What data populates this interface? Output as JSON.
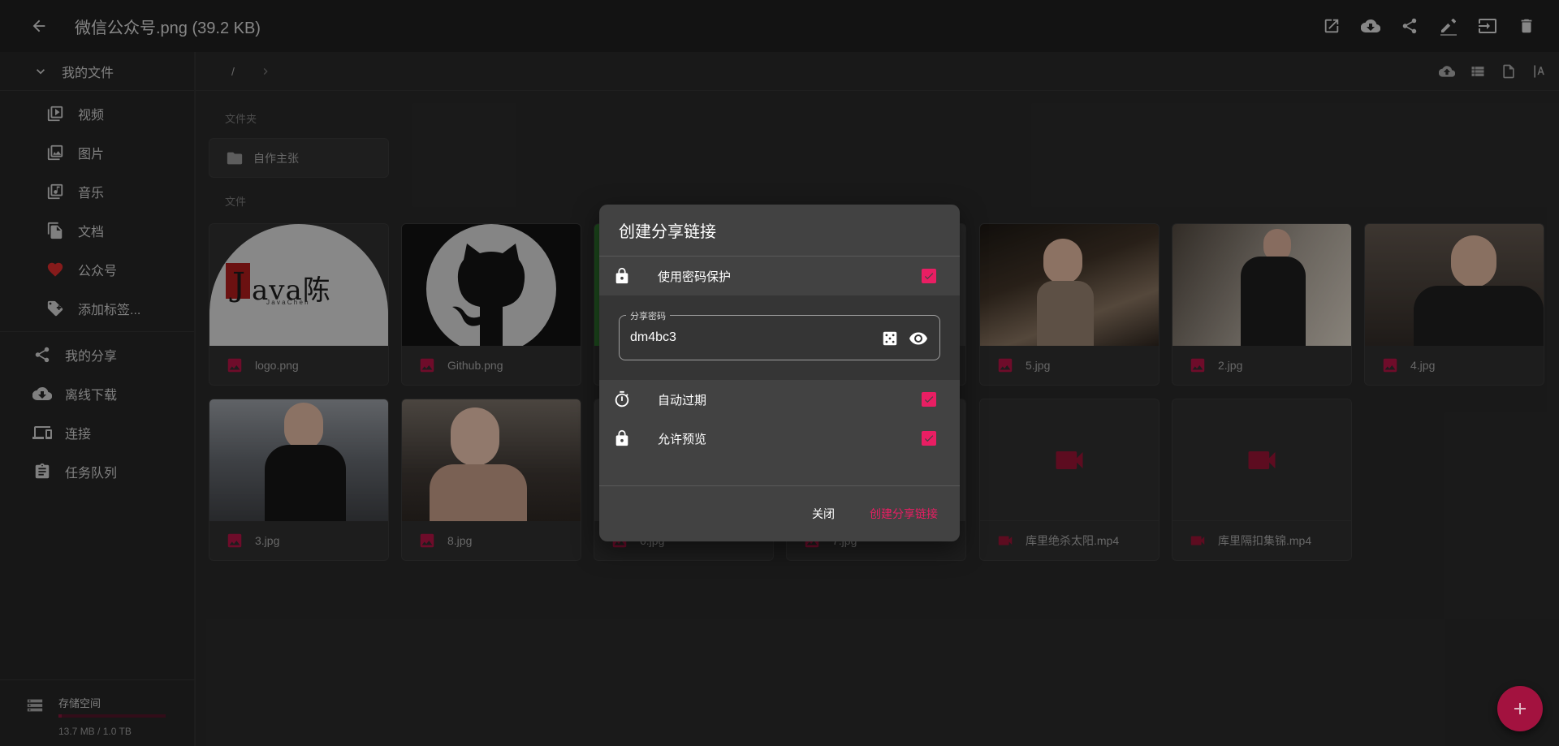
{
  "app": {
    "title": "微信公众号.png (39.2 KB)"
  },
  "sidebar": {
    "header": "我的文件",
    "sub_items": [
      {
        "label": "视频",
        "icon": "video-library-icon"
      },
      {
        "label": "图片",
        "icon": "photo-library-icon"
      },
      {
        "label": "音乐",
        "icon": "music-library-icon"
      },
      {
        "label": "文档",
        "icon": "file-copy-icon"
      },
      {
        "label": "公众号",
        "icon": "heart-icon"
      },
      {
        "label": "添加标签...",
        "icon": "tag-add-icon"
      }
    ],
    "items": [
      {
        "label": "我的分享",
        "icon": "share-icon"
      },
      {
        "label": "离线下载",
        "icon": "cloud-download-icon"
      },
      {
        "label": "连接",
        "icon": "devices-icon"
      },
      {
        "label": "任务队列",
        "icon": "clipboard-icon"
      }
    ],
    "storage": {
      "title": "存储空间",
      "usage": "13.7 MB / 1.0 TB",
      "fraction": 0.03
    }
  },
  "breadcrumb": {
    "root": "/"
  },
  "main": {
    "folders_label": "文件夹",
    "files_label": "文件",
    "folders": [
      {
        "name": "自作主张"
      }
    ],
    "files": [
      {
        "name": "logo.png",
        "thumb": "java-logo"
      },
      {
        "name": "Github.png",
        "thumb": "github"
      },
      {
        "name": "",
        "thumb": "hidden"
      },
      {
        "name": "",
        "thumb": "hidden"
      },
      {
        "name": "5.jpg",
        "thumb": "photo"
      },
      {
        "name": "2.jpg",
        "thumb": "photo"
      },
      {
        "name": "4.jpg",
        "thumb": "photo"
      },
      {
        "name": "3.jpg",
        "thumb": "photo"
      },
      {
        "name": "8.jpg",
        "thumb": "photo"
      },
      {
        "name": "6.jpg",
        "thumb": "hidden"
      },
      {
        "name": "7.jpg",
        "thumb": "hidden"
      },
      {
        "name": "库里绝杀太阳.mp4",
        "thumb": "video"
      },
      {
        "name": "库里隔扣集锦.mp4",
        "thumb": "video"
      }
    ]
  },
  "dialog": {
    "title": "创建分享链接",
    "password_option": "使用密码保护",
    "password_label": "分享密码",
    "password_value": "dm4bc3",
    "expire_option": "自动过期",
    "preview_option": "允许预览",
    "close_label": "关闭",
    "create_label": "创建分享链接"
  },
  "colors": {
    "accent": "#e91e63",
    "fab": "#a3123f"
  }
}
